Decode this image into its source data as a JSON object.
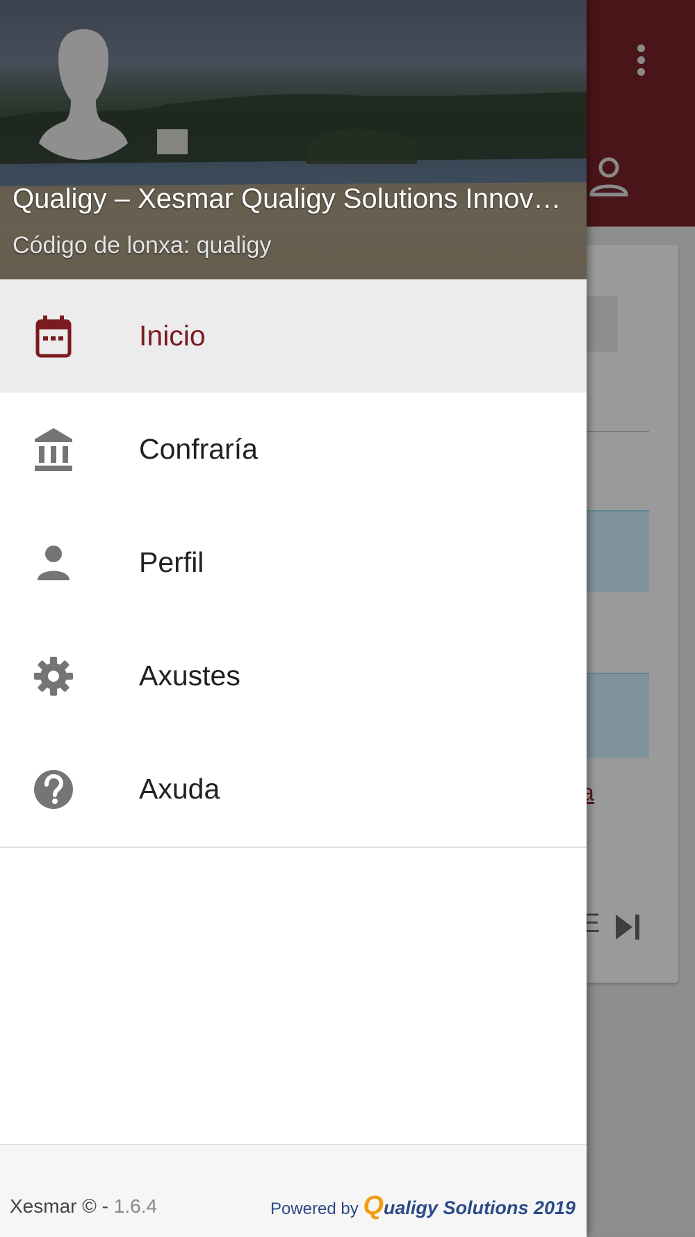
{
  "colors": {
    "toolbar": "#4a1519",
    "accent": "#7b1a20",
    "icon_gray": "#757575",
    "active_bg": "#ececec"
  },
  "background_app": {
    "link_fragment": "a",
    "button_fragment": "E",
    "icons": [
      "more-vertical-icon",
      "account-outline-icon",
      "skip-next-icon"
    ]
  },
  "drawer": {
    "header": {
      "avatar_icon": "person-silhouette-icon",
      "title": "Qualigy – Xesmar Qualigy Solutions Innovati…",
      "subtitle": "Código de lonxa: qualigy"
    },
    "menu": [
      {
        "label": "Inicio",
        "icon": "calendar-icon",
        "active": true
      },
      {
        "label": "Confraría",
        "icon": "bank-icon",
        "active": false
      },
      {
        "label": "Perfil",
        "icon": "person-icon",
        "active": false
      },
      {
        "label": "Axustes",
        "icon": "gear-icon",
        "active": false
      },
      {
        "label": "Axuda",
        "icon": "help-circle-icon",
        "active": false
      }
    ],
    "footer": {
      "copyright": "Xesmar © - ",
      "version": "1.6.4",
      "powered_by": "Powered by ",
      "brand_q": "Q",
      "brand_rest": "ualigy Solutions 2019"
    }
  }
}
